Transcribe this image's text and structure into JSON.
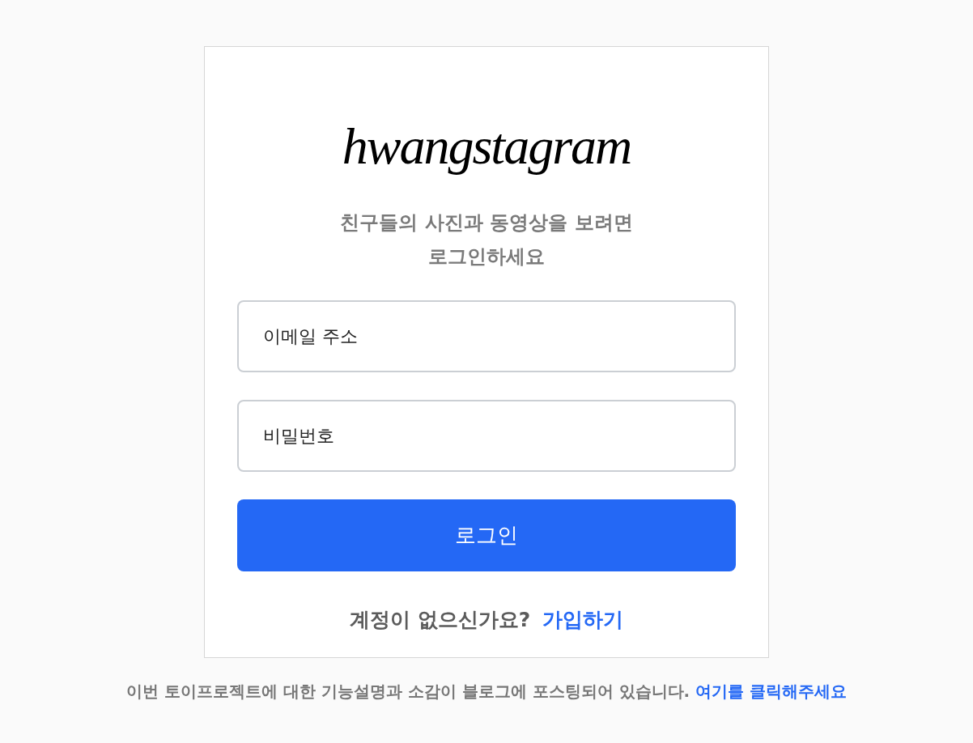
{
  "logo": {
    "text": "hwangstagram"
  },
  "login_card": {
    "subtitle_lines": [
      "친구들의 사진과 동영상을 보려면",
      "로그인하세요"
    ],
    "email_field": {
      "placeholder": "이메일 주소"
    },
    "password_field": {
      "placeholder": "비밀번호"
    },
    "login_button": "로그인",
    "signup_prompt": {
      "text": "계정이 없으신가요?",
      "link": "가입하기"
    }
  },
  "footer": {
    "text": "이번 토이프로젝트에 대한 기능설명과 소감이 블로그에 포스팅되어 있습니다.",
    "link": "여기를 클릭해주세요"
  }
}
